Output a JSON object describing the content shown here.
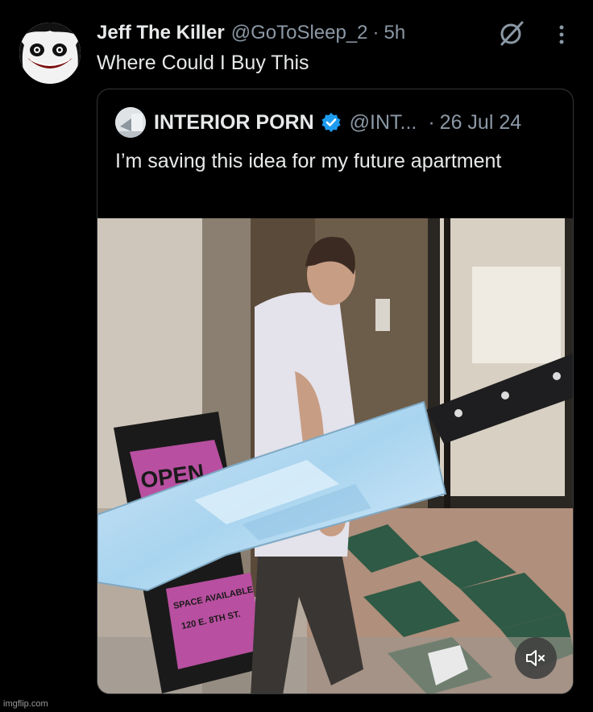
{
  "tweet": {
    "author_name": "Jeff The Killer",
    "author_handle": "@GoToSleep_2",
    "separator": "·",
    "time": "5h",
    "text": "Where Could I Buy This",
    "grok_icon": "grok-icon",
    "more_icon": "more-vertical-icon"
  },
  "quote": {
    "author_name": "INTERIOR PORN",
    "author_handle": "@INT...",
    "separator": "·",
    "date": "26 Jul 24",
    "verified_icon": "verified-badge-icon",
    "text": "I’m saving this idea for my future apartment",
    "media": {
      "sign_text": "OPEN",
      "sign_sub_1": "SPACE AVAILABLE",
      "sign_sub_2": "120 E. 8TH ST.",
      "mute_icon": "volume-muted-icon"
    }
  },
  "watermark": "imgflip.com",
  "colors": {
    "background": "#000000",
    "primary_text": "#e7e9ea",
    "secondary_text": "#8b98a5",
    "verified": "#1d9bf0",
    "border": "#333639"
  }
}
